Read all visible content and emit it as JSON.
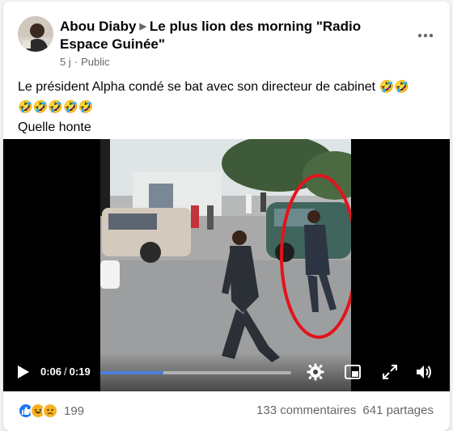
{
  "post": {
    "author": "Abou Diaby",
    "group": "Le plus lion des morning \"Radio Espace Guinée\"",
    "time": "5 j",
    "separator": "·",
    "audience": "Public",
    "text_line1": "Le président Alpha condé se bat avec son directeur de cabinet",
    "text_line1_emoji": "🤣🤣",
    "text_line2_emoji": "🤣🤣🤣🤣🤣",
    "text_line3": "Quelle honte"
  },
  "video": {
    "current_time": "0:06",
    "separator": "/",
    "duration": "0:19",
    "progress_fraction": 0.33
  },
  "reactions": {
    "count": "199",
    "icons": [
      "like-icon",
      "haha-icon",
      "sad-icon"
    ],
    "colors": {
      "like": "#1877f2",
      "haha": "#f7b125",
      "sad": "#f7b125"
    }
  },
  "stats": {
    "comments": "133 commentaires",
    "shares": "641 partages"
  },
  "colors": {
    "accent": "#1877f2",
    "secondary_text": "#65676b",
    "annotation_circle": "#e3131b"
  }
}
